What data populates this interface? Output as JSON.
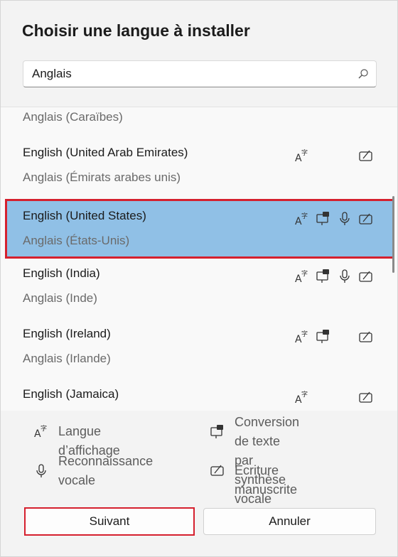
{
  "dialog": {
    "title": "Choisir une langue à installer"
  },
  "search": {
    "value": "Anglais",
    "icon": "search-icon"
  },
  "languages": [
    {
      "primary": "",
      "secondary": "Anglais (Caraïbes)",
      "features": []
    },
    {
      "primary": "English (United Arab Emirates)",
      "secondary": "Anglais (Émirats arabes unis)",
      "features": [
        "language-pack",
        "handwriting"
      ]
    },
    {
      "primary": "English (United States)",
      "secondary": "Anglais (États-Unis)",
      "features": [
        "language-pack",
        "text-to-speech",
        "speech",
        "handwriting"
      ],
      "selected": true
    },
    {
      "primary": "English (India)",
      "secondary": "Anglais (Inde)",
      "features": [
        "language-pack",
        "text-to-speech",
        "speech",
        "handwriting"
      ]
    },
    {
      "primary": "English (Ireland)",
      "secondary": "Anglais (Irlande)",
      "features": [
        "language-pack",
        "text-to-speech",
        "handwriting"
      ]
    },
    {
      "primary": "English (Jamaica)",
      "secondary": "",
      "features": [
        "language-pack",
        "handwriting"
      ]
    }
  ],
  "legend": {
    "display_language": "Langue d’affichage",
    "tts_line1": "Conversion de texte",
    "tts_line2": "par synthèse vocale",
    "speech_line1": "Reconnaissance",
    "speech_line2": "vocale",
    "handwriting": "Écriture manuscrite"
  },
  "buttons": {
    "next": "Suivant",
    "cancel": "Annuler"
  },
  "colors": {
    "selected_bg": "#90c0e6",
    "highlight_border": "#d5202e"
  }
}
